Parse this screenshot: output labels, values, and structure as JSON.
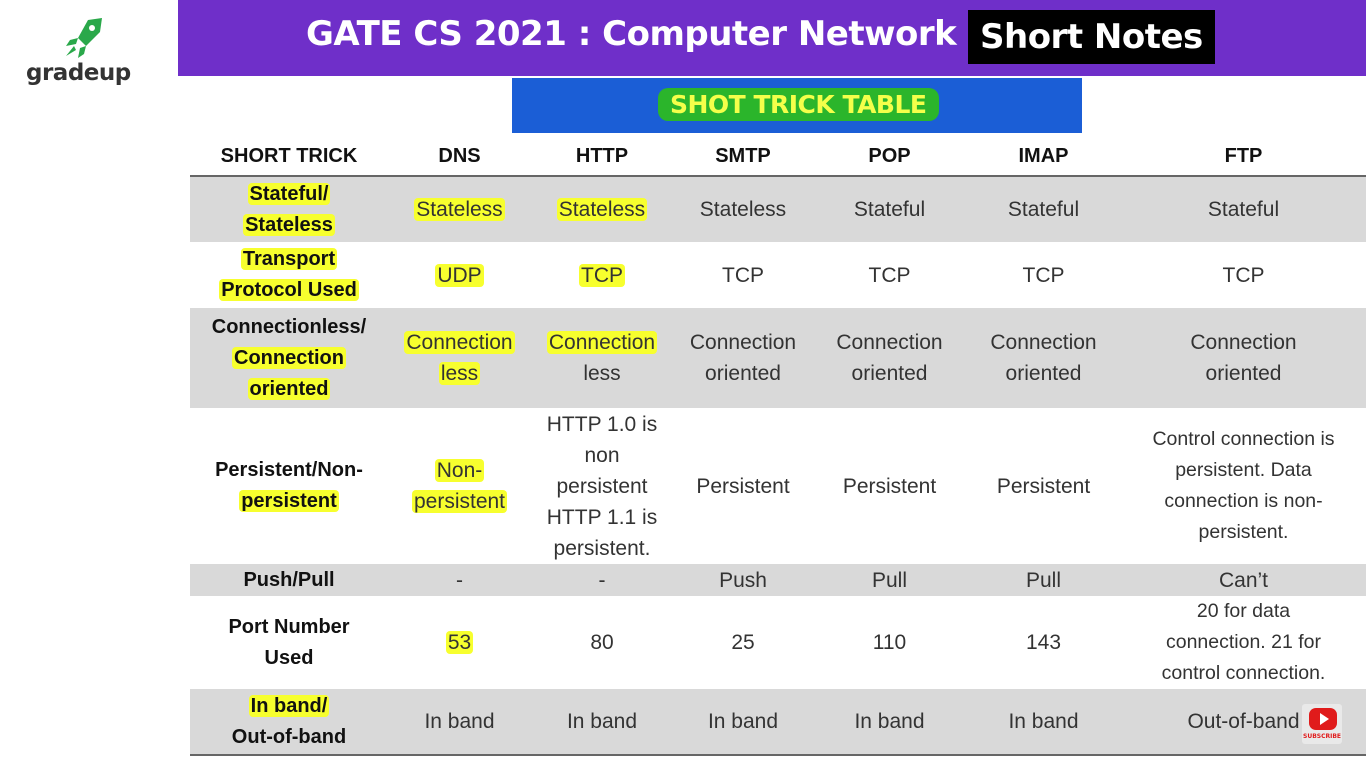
{
  "brand": {
    "name": "gradeup"
  },
  "banner": {
    "title": "GATE CS 2021 : Computer Network",
    "badge": "Short Notes"
  },
  "subbar": {
    "title": "SHOT TRICK TABLE"
  },
  "table": {
    "headers": [
      "SHORT TRICK",
      "DNS",
      "HTTP",
      "SMTP",
      "POP",
      "IMAP",
      "FTP"
    ],
    "rows": [
      {
        "label": [
          "Stateful/",
          "Stateless"
        ],
        "cells": [
          [
            "Stateless"
          ],
          [
            "Stateless"
          ],
          [
            "Stateless"
          ],
          [
            "Stateful"
          ],
          [
            "Stateful"
          ],
          [
            "Stateful"
          ]
        ]
      },
      {
        "label": [
          "Transport",
          "Protocol Used"
        ],
        "cells": [
          [
            "UDP"
          ],
          [
            "TCP"
          ],
          [
            "TCP"
          ],
          [
            "TCP"
          ],
          [
            "TCP"
          ],
          [
            "TCP"
          ]
        ]
      },
      {
        "label": [
          "Connectionless/",
          "Connection",
          "oriented"
        ],
        "cells": [
          [
            "Connection",
            "less"
          ],
          [
            "Connection",
            "less"
          ],
          [
            "Connection",
            "oriented"
          ],
          [
            "Connection",
            "oriented"
          ],
          [
            "Connection",
            "oriented"
          ],
          [
            "Connection",
            "oriented"
          ]
        ]
      },
      {
        "label": [
          "Persistent/Non-",
          "persistent"
        ],
        "cells": [
          [
            "Non-",
            "persistent"
          ],
          [
            "HTTP 1.0 is",
            "non",
            "persistent",
            "HTTP 1.1 is",
            "persistent."
          ],
          [
            "Persistent"
          ],
          [
            "Persistent"
          ],
          [
            "Persistent"
          ],
          [
            "Control connection is",
            "persistent. Data",
            "connection is non-",
            "persistent."
          ]
        ]
      },
      {
        "label": [
          "Push/Pull"
        ],
        "cells": [
          [
            "-"
          ],
          [
            "-"
          ],
          [
            "Push"
          ],
          [
            "Pull"
          ],
          [
            "Pull"
          ],
          [
            "Can’t"
          ]
        ]
      },
      {
        "label": [
          "Port Number",
          "Used"
        ],
        "cells": [
          [
            "53"
          ],
          [
            "80"
          ],
          [
            "25"
          ],
          [
            "110"
          ],
          [
            "143"
          ],
          [
            "20 for data",
            "connection. 21 for",
            "control connection."
          ]
        ]
      },
      {
        "label": [
          "In band/",
          "Out-of-band"
        ],
        "cells": [
          [
            "In band"
          ],
          [
            "In band"
          ],
          [
            "In band"
          ],
          [
            "In band"
          ],
          [
            "In band"
          ],
          [
            "Out-of-band"
          ]
        ]
      }
    ]
  },
  "youtube": {
    "label": "SUBSCRIBE",
    "icon": "youtube-play-icon"
  },
  "colors": {
    "banner": "#6f2fc9",
    "subbar": "#1b5ed6",
    "highlight": "#f7ff2e",
    "row_shade": "#d9d9d9"
  }
}
